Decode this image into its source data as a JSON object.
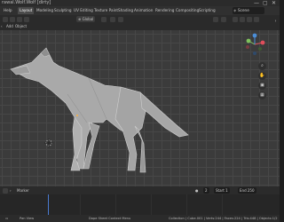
{
  "window": {
    "title": "rawal.Wolf.Wolf [dirty]",
    "controls": [
      "—",
      "▢",
      "✕"
    ]
  },
  "menu": [
    "Help"
  ],
  "workspace_tabs": [
    "Layout",
    "Modeling",
    "Sculpting",
    "UV Editing",
    "Texture Paint",
    "Shading",
    "Animation",
    "Rendering",
    "Compositing",
    "Scripting"
  ],
  "active_tab": "Layout",
  "scene": {
    "icon": "scene-icon",
    "name": "Scene"
  },
  "viewport_header": {
    "orientation_label": "Global",
    "menus": [
      "Add",
      "Object"
    ]
  },
  "gizmo_axes": {
    "x_color": "#e04e5b",
    "y_color": "#7fc25c",
    "z_color": "#4b8ed8"
  },
  "navigation_tools": [
    {
      "icon": "zoom-icon",
      "glyph": "⌕"
    },
    {
      "icon": "hand-pan-icon",
      "glyph": "✋"
    },
    {
      "icon": "camera-icon",
      "glyph": "▣"
    },
    {
      "icon": "grid-icon",
      "glyph": "▦"
    }
  ],
  "timeline": {
    "marker_label": "Marker",
    "start_label": "Start",
    "start_value": "1",
    "end_label": "End",
    "end_value": "250",
    "current_frame": "2"
  },
  "status": {
    "left": "Pan View",
    "middle": "Dope Sheet Context Menu",
    "right": "Collection | Cube.001 | Verts:244 | Faces:224 | Tris:448 | Objects:1/2"
  },
  "colors": {
    "accent": "#4a7bd0",
    "mesh_fill": "#a9a9a9",
    "mesh_edge": "#d8d8d8",
    "grid_bg": "#3b3b3b"
  }
}
